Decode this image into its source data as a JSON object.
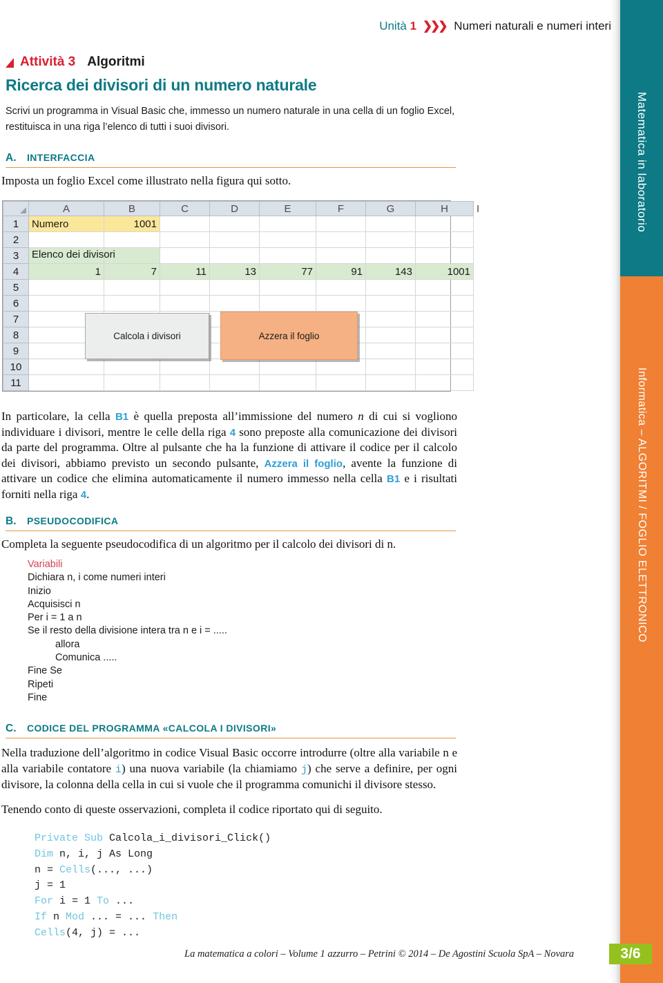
{
  "header": {
    "unita_label": "Unità",
    "unita_number": "1",
    "chevrons": "❯❯❯",
    "title": "Numeri naturali e numeri interi"
  },
  "activity": {
    "label": "Attività 3",
    "topic": "Algoritmi"
  },
  "main_title": "Ricerca dei divisori di un numero naturale",
  "intro": "Scrivi un programma in Visual Basic che, immesso un numero naturale in una cella di un foglio Excel, restituisca in una riga l’elenco di tutti i suoi divisori.",
  "sections": {
    "a": {
      "letter": "A.",
      "name": "INTERFACCIA",
      "paragraph": "Imposta un foglio Excel come illustrato nella figura qui sotto."
    },
    "b": {
      "letter": "B.",
      "name": "PSEUDOCODIFICA",
      "paragraph": "Completa la seguente pseudocodifica di un algoritmo per il calcolo dei divisori di n."
    },
    "c": {
      "letter": "C.",
      "name": "CODICE DEL PROGRAMMA «CALCOLA I DIVISORI»",
      "paragraph_1a": "Nella traduzione dell’algoritmo in codice Visual Basic occorre introdurre (oltre alla variabile n e alla variabile contatore ",
      "paragraph_1b": "i",
      "paragraph_1c": ") una nuova variabile (la chiamiamo ",
      "paragraph_1d": "j",
      "paragraph_1e": ") che serve a definire, per ogni divisore, la colonna della cella in cui si vuole che il programma comunichi il divisore stesso.",
      "paragraph_2": "Tenendo conto di queste osservazioni, completa il codice riportato qui di seguito."
    }
  },
  "mid_paragraph": {
    "p1": "In particolare, la cella ",
    "cell1": "B1",
    "p2": " è quella preposta all’immissione del numero ",
    "n1": "n",
    "p3": " di cui si vogliono individuare i divisori, mentre le celle della riga ",
    "row1": "4",
    "p4": " sono preposte alla comunicazione dei divisori da parte del programma. Oltre al pulsante che ha la funzione di attivare il codice per il calcolo dei divisori, abbiamo previsto un secondo pulsante, ",
    "btn": "Azzera il foglio",
    "p5": ", avente la funzione di attivare un codice che elimina automaticamente il numero immesso nella cella ",
    "cell2": "B1",
    "p6": " e i risultati forniti nella riga ",
    "row2": "4",
    "p7": "."
  },
  "spreadsheet": {
    "column_headers": [
      "A",
      "B",
      "C",
      "D",
      "E",
      "F",
      "G",
      "H",
      "I"
    ],
    "row_headers": [
      "1",
      "2",
      "3",
      "4",
      "5",
      "6",
      "7",
      "8",
      "9",
      "10",
      "11"
    ],
    "cells": {
      "A1": "Numero",
      "B1": "1001",
      "A3": "Elenco dei divisori",
      "row4": [
        "1",
        "7",
        "11",
        "13",
        "77",
        "91",
        "143",
        "1001"
      ]
    },
    "buttons": {
      "calcola": "Calcola i divisori",
      "azzera": "Azzera il foglio"
    },
    "colors": {
      "yellow_fill": "#fbe79a",
      "green_fill": "#d8ead0",
      "orange_button": "#f5b183",
      "grey_button": "#eceded"
    }
  },
  "pseudocode": [
    {
      "text": "Variabili",
      "style": "red",
      "indent": 0
    },
    {
      "text": "Dichiara n, i come numeri interi",
      "style": "normal",
      "indent": 0
    },
    {
      "text": "Inizio",
      "style": "normal",
      "indent": 0
    },
    {
      "text": "Acquisisci n",
      "style": "normal",
      "indent": 0
    },
    {
      "text": "Per i = 1 a n",
      "style": "normal",
      "indent": 0
    },
    {
      "text": "Se il resto della divisione intera tra n e i = .....",
      "style": "normal",
      "indent": 0
    },
    {
      "text": "allora",
      "style": "normal",
      "indent": 1
    },
    {
      "text": "Comunica .....",
      "style": "normal",
      "indent": 1
    },
    {
      "text": "Fine Se",
      "style": "normal",
      "indent": 0
    },
    {
      "text": "Ripeti",
      "style": "normal",
      "indent": 0
    },
    {
      "text": "Fine",
      "style": "normal",
      "indent": 0
    }
  ],
  "vbcode": {
    "line1_k": "Private Sub ",
    "line1_t": "Calcola_i_divisori_Click()",
    "line2_k": "Dim ",
    "line2_t": "n, i, j As Long",
    "line3_t1": "n = ",
    "line3_k": "Cells",
    "line3_t2": "(..., ...)",
    "line4_t": "j = 1",
    "line5_k1": "For ",
    "line5_t1": "i = 1 ",
    "line5_k2": "To ",
    "line5_t2": "...",
    "line6_k1": "If ",
    "line6_t1": "n ",
    "line6_k2": "Mod ",
    "line6_t2": "... = ... ",
    "line6_k3": "Then",
    "line7_k": "Cells",
    "line7_t": "(4, j) = ..."
  },
  "sidebar": {
    "band_top": "Matematica in laboratorio",
    "band_bottom": "Informatica – ALGORITMI / FOGLIO ELETTRONICO",
    "colors": {
      "teal": "#0d7a85",
      "orange": "#f08033"
    }
  },
  "footer": {
    "credit": "La matematica a colori – Volume 1 azzurro – Petrini © 2014 – De Agostini Scuola SpA – Novara",
    "page": "3/6",
    "badge_color": "#95c11f"
  }
}
